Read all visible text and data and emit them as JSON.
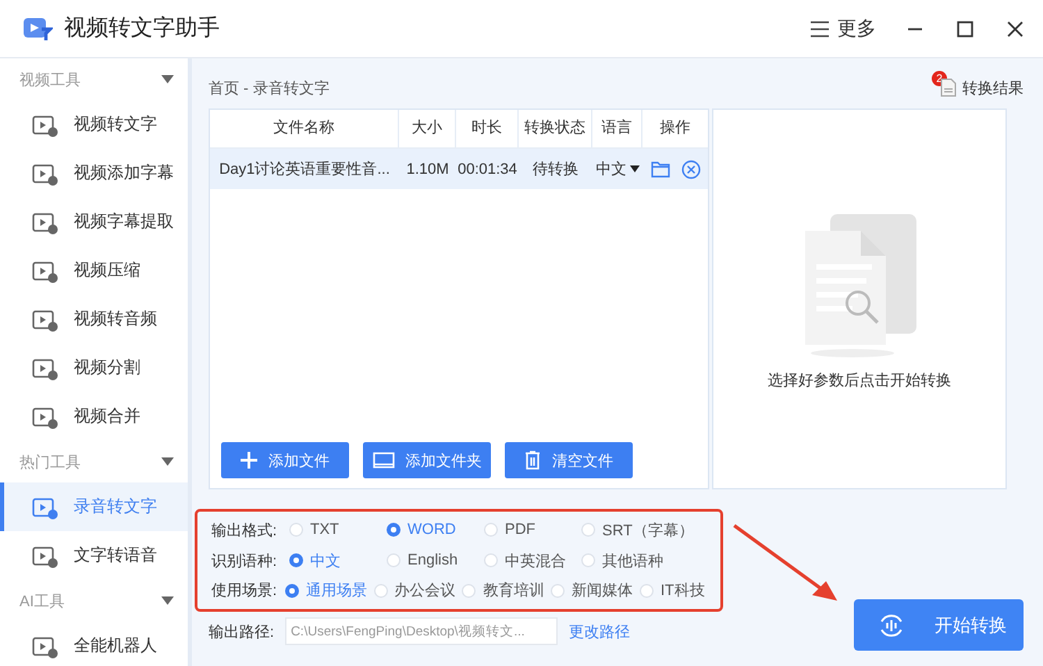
{
  "app": {
    "title": "视频转文字助手",
    "menu_label": "更多"
  },
  "sidebar": {
    "groups": [
      {
        "title": "视频工具",
        "items": [
          {
            "label": "视频转文字",
            "selected": false
          },
          {
            "label": "视频添加字幕",
            "selected": false
          },
          {
            "label": "视频字幕提取",
            "selected": false
          },
          {
            "label": "视频压缩",
            "selected": false
          },
          {
            "label": "视频转音频",
            "selected": false
          },
          {
            "label": "视频分割",
            "selected": false
          },
          {
            "label": "视频合并",
            "selected": false
          }
        ]
      },
      {
        "title": "热门工具",
        "items": [
          {
            "label": "录音转文字",
            "selected": true
          },
          {
            "label": "文字转语音",
            "selected": false
          }
        ]
      },
      {
        "title": "AI工具",
        "items": [
          {
            "label": "全能机器人",
            "selected": false
          }
        ]
      }
    ]
  },
  "breadcrumb": "首页 - 录音转文字",
  "results": {
    "label": "转换结果",
    "badge": "2"
  },
  "table": {
    "columns": [
      "文件名称",
      "大小",
      "时长",
      "转换状态",
      "语言",
      "操作"
    ],
    "rows": [
      {
        "name": "Day1讨论英语重要性音...",
        "size": "1.10M",
        "duration": "00:01:34",
        "status": "待转换",
        "language": "中文",
        "selected": true
      }
    ]
  },
  "actions": [
    {
      "label": "添加文件",
      "kind": "add"
    },
    {
      "label": "添加文件夹",
      "kind": "folder"
    },
    {
      "label": "清空文件",
      "kind": "clear"
    }
  ],
  "preview": {
    "message": "选择好参数后点击开始转换"
  },
  "options": [
    {
      "label": "输出格式:",
      "choices": [
        {
          "label": "TXT",
          "selected": false
        },
        {
          "label": "WORD",
          "selected": true
        },
        {
          "label": "PDF",
          "selected": false
        },
        {
          "label": "SRT（字幕）",
          "selected": false
        }
      ]
    },
    {
      "label": "识别语种:",
      "choices": [
        {
          "label": "中文",
          "selected": true
        },
        {
          "label": "English",
          "selected": false
        },
        {
          "label": "中英混合",
          "selected": false
        },
        {
          "label": "其他语种",
          "selected": false
        }
      ]
    },
    {
      "label": "使用场景:",
      "choices": [
        {
          "label": "通用场景",
          "selected": true
        },
        {
          "label": "办公会议",
          "selected": false
        },
        {
          "label": "教育培训",
          "selected": false
        },
        {
          "label": "新闻媒体",
          "selected": false
        },
        {
          "label": "IT科技",
          "selected": false
        }
      ]
    }
  ],
  "output_path": {
    "label": "输出路径:",
    "value": "C:\\Users\\FengPing\\Desktop\\视频转文...",
    "link": "更改路径"
  },
  "start_button": "开始转换"
}
